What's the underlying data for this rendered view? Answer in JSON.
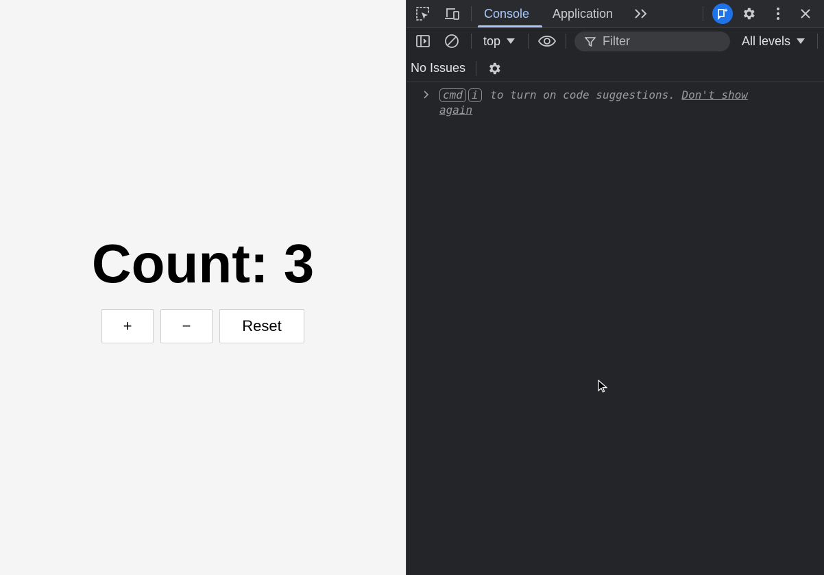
{
  "page": {
    "count_text": "Count: 3",
    "buttons": {
      "plus": "+",
      "minus": "−",
      "reset": "Reset"
    }
  },
  "devtools": {
    "tabs": [
      "Console",
      "Application"
    ],
    "active_tab": "Console",
    "toolbar": {
      "context": "top",
      "filter_placeholder": "Filter",
      "levels": "All levels"
    },
    "issues_label": "No Issues",
    "console_message": {
      "key1": "cmd",
      "key2": "i",
      "text": " to turn on code suggestions. ",
      "link": "Don't show again"
    },
    "icons": {
      "inspect": "inspect-element-icon",
      "device": "device-toolbar-icon",
      "more_tabs": "chevron-double-right-icon",
      "ai_assistant": "ai-assistant-icon",
      "settings": "gear-icon",
      "menu": "more-vertical-icon",
      "close": "close-icon"
    },
    "colors": {
      "accent": "#a8c7fa",
      "ai_badge": "#1f73e8",
      "panel_bg": "#242528"
    }
  }
}
